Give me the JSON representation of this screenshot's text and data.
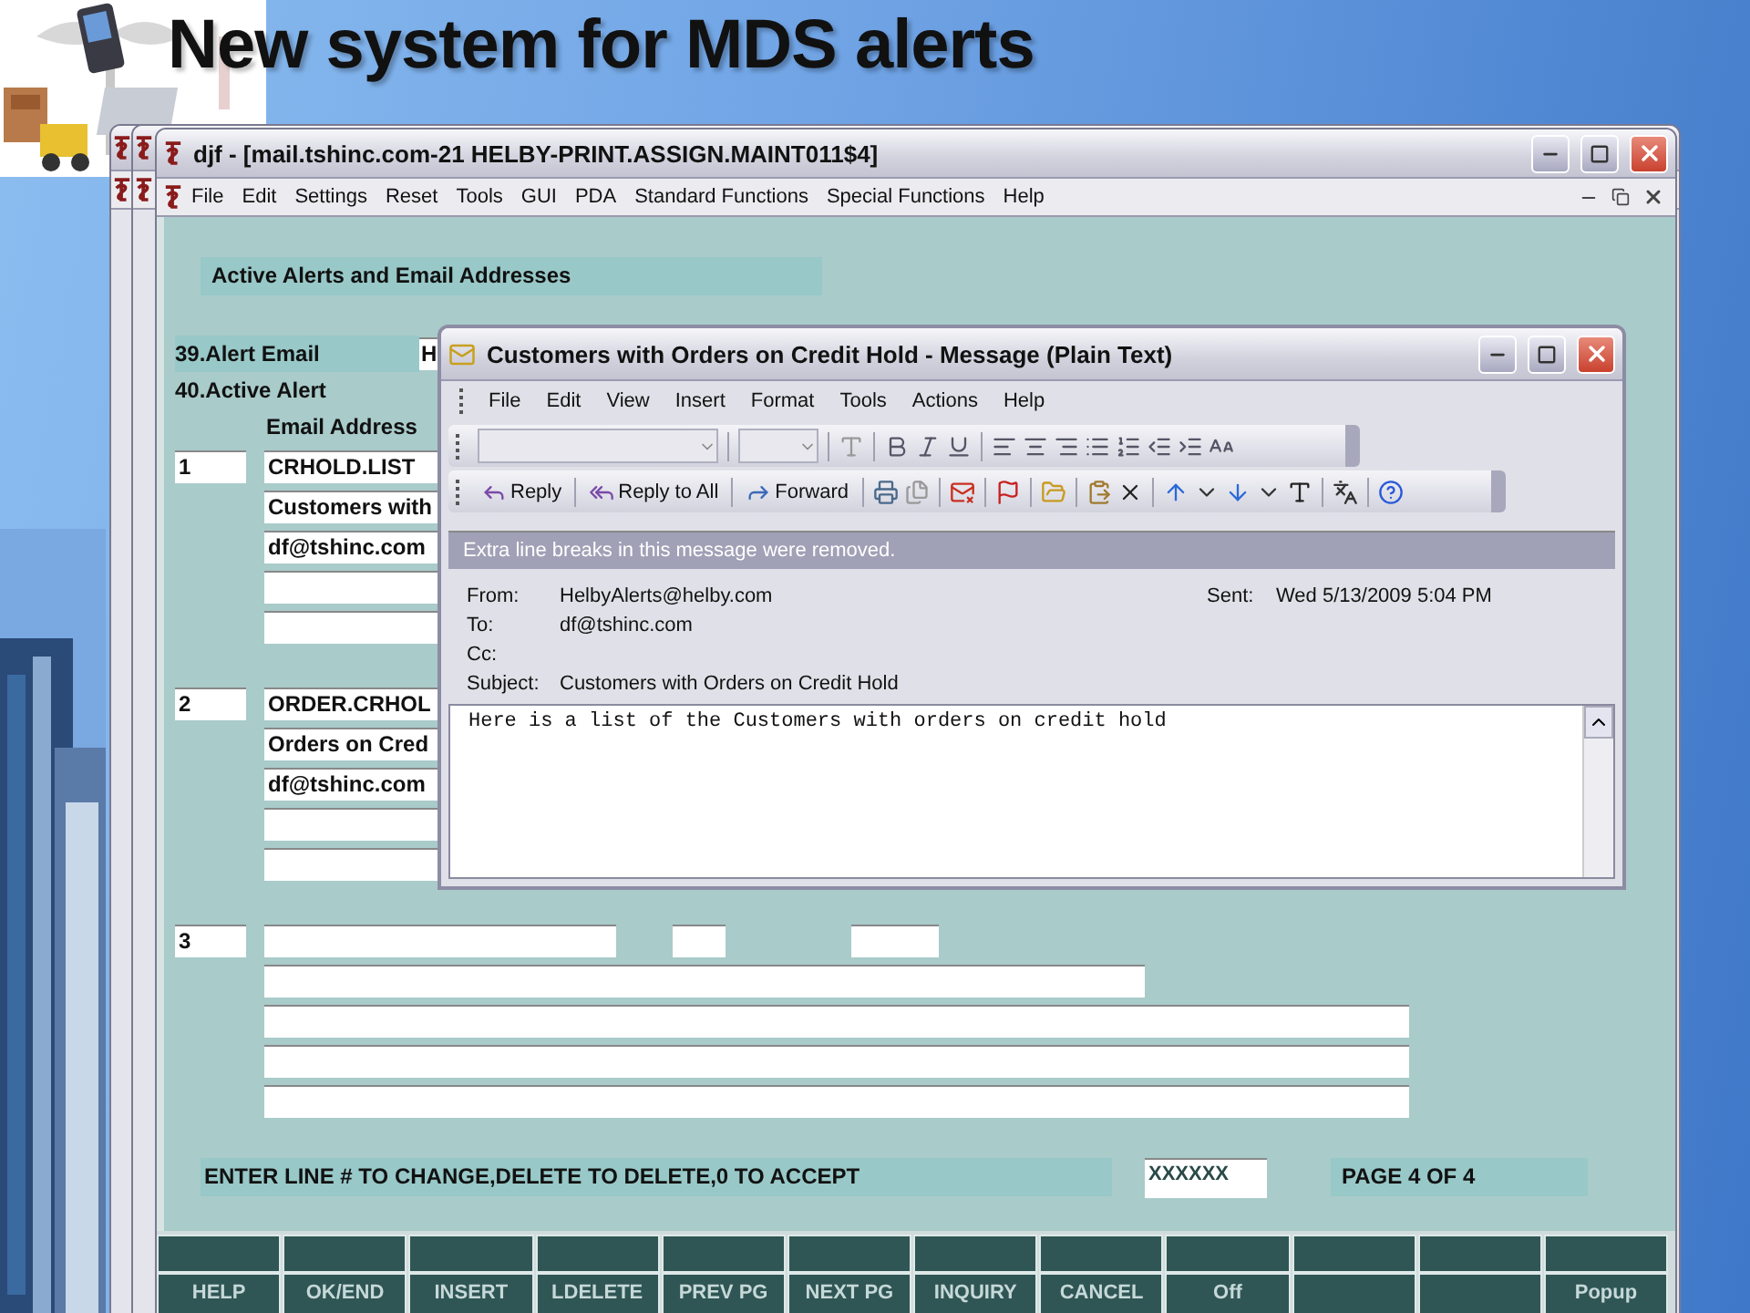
{
  "slide": {
    "title": "New system for MDS alerts"
  },
  "main_window": {
    "title": "djf - [mail.tshinc.com-21 HELBY-PRINT.ASSIGN.MAINT011$4]",
    "menu": [
      "File",
      "Edit",
      "Settings",
      "Reset",
      "Tools",
      "GUI",
      "PDA",
      "Standard Functions",
      "Special Functions",
      "Help"
    ]
  },
  "form": {
    "heading": "Active Alerts and Email Addresses",
    "alert_email_label": "39.Alert Email",
    "alert_email_value": "H",
    "active_alert_label": "40.Active Alert",
    "column_header": "Email Address",
    "entries": [
      {
        "number": "1",
        "lines": [
          "CRHOLD.LIST",
          "Customers with",
          "df@tshinc.com"
        ]
      },
      {
        "number": "2",
        "lines": [
          "ORDER.CRHOL",
          "Orders on Cred",
          "df@tshinc.com"
        ]
      },
      {
        "number": "3"
      }
    ],
    "prompt": "ENTER LINE # TO CHANGE,DELETE TO DELETE,0 TO ACCEPT",
    "input_value": "XXXXXX",
    "page": "PAGE  4 OF  4"
  },
  "function_keys": [
    {
      "kind": "key",
      "label": "HELP"
    },
    {
      "kind": "key",
      "label": "OK/END"
    },
    {
      "kind": "key",
      "label": "INSERT"
    },
    {
      "kind": "key",
      "label": "LDELETE"
    },
    {
      "kind": "key",
      "label": "PREV PG"
    },
    {
      "kind": "key",
      "label": "NEXT PG"
    },
    {
      "kind": "key",
      "label": "INQUIRY"
    },
    {
      "kind": "key",
      "label": "CANCEL"
    },
    {
      "kind": "key",
      "label": "Off"
    },
    {
      "kind": "blank"
    },
    {
      "kind": "blank"
    },
    {
      "kind": "key",
      "label": "Popup"
    }
  ],
  "email_window": {
    "title": "Customers with Orders on Credit Hold - Message (Plain Text)",
    "menu": [
      "File",
      "Edit",
      "View",
      "Insert",
      "Format",
      "Tools",
      "Actions",
      "Help"
    ],
    "actions": [
      "Reply",
      "Reply to All",
      "Forward"
    ],
    "info_bar": "Extra line breaks in this message were removed.",
    "headers": [
      {
        "label": "From:",
        "value": "HelbyAlerts@helby.com"
      },
      {
        "label": "To:",
        "value": "df@tshinc.com"
      },
      {
        "label": "Cc:"
      },
      {
        "label": "Subject:",
        "value": "Customers with Orders on Credit Hold"
      }
    ],
    "sent": {
      "label": "Sent:",
      "value": "Wed 5/13/2009 5:04 PM"
    },
    "body": "Here is a list of the Customers with orders on credit hold"
  }
}
